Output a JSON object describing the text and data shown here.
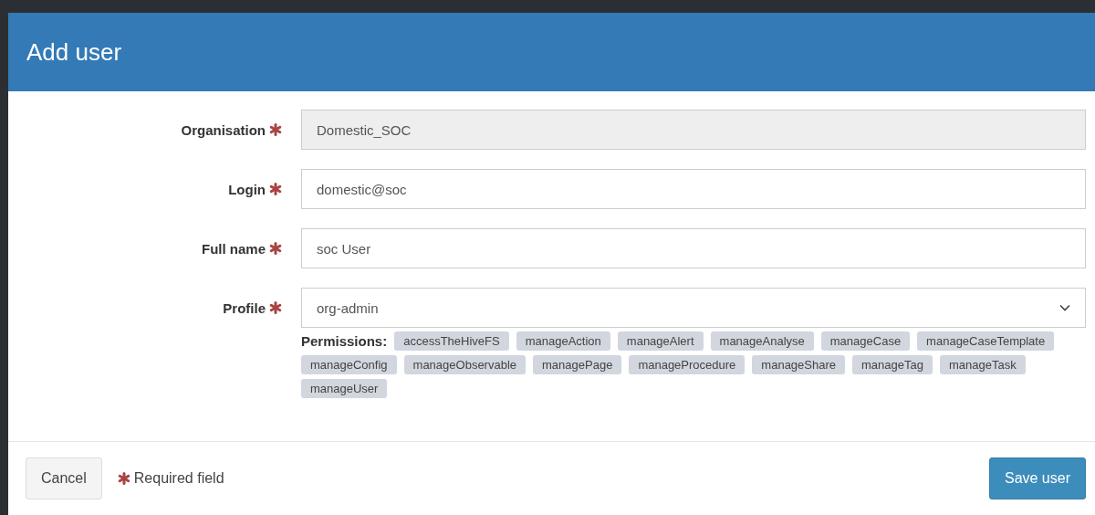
{
  "dialog": {
    "title": "Add user"
  },
  "fields": [
    {
      "label": "Organisation",
      "required": true,
      "kind": "text",
      "value": "Domestic_SOC",
      "disabled": true
    },
    {
      "label": "Login",
      "required": true,
      "kind": "text",
      "value": "domestic@soc",
      "disabled": false
    },
    {
      "label": "Full name",
      "required": true,
      "kind": "text",
      "value": "soc User",
      "disabled": false
    },
    {
      "label": "Profile",
      "required": true,
      "kind": "select",
      "value": "org-admin",
      "disabled": false
    }
  ],
  "permissions": {
    "label": "Permissions:",
    "tags": [
      "accessTheHiveFS",
      "manageAction",
      "manageAlert",
      "manageAnalyse",
      "manageCase",
      "manageCaseTemplate",
      "manageConfig",
      "manageObservable",
      "managePage",
      "manageProcedure",
      "manageShare",
      "manageTag",
      "manageTask",
      "manageUser"
    ]
  },
  "footer": {
    "cancel": "Cancel",
    "required_note": "Required field",
    "save": "Save user"
  }
}
